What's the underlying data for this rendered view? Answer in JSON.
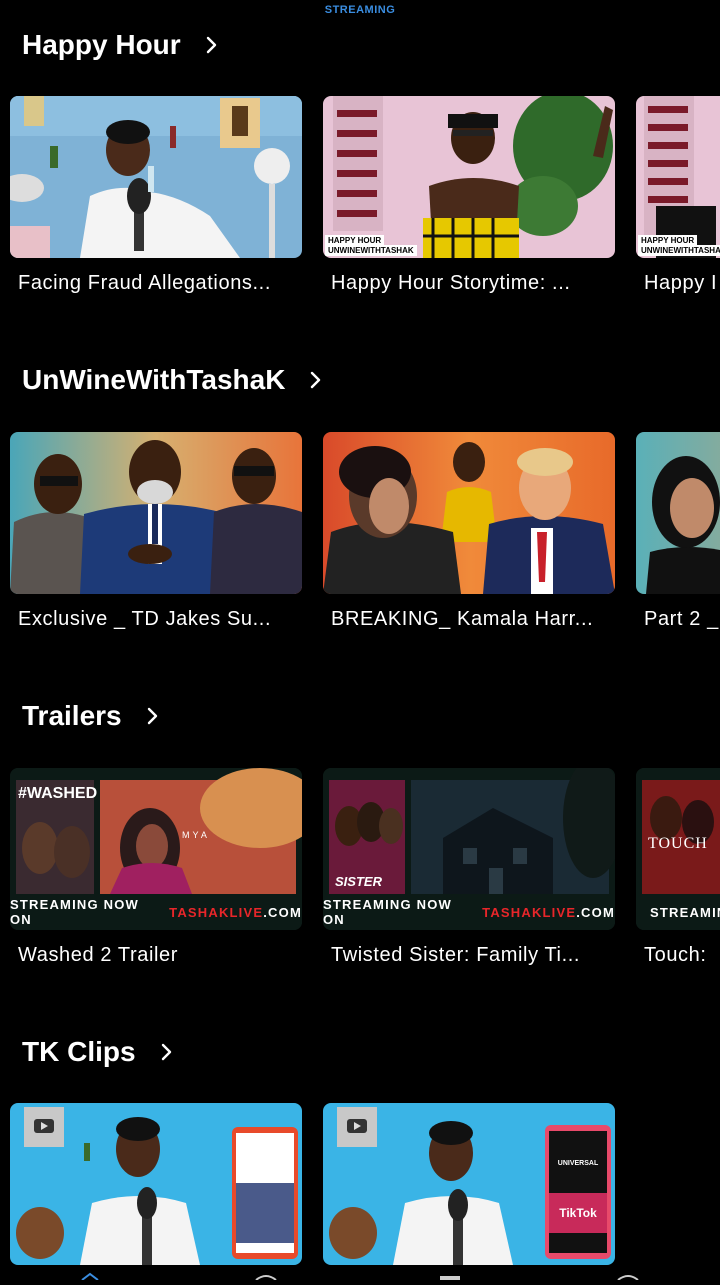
{
  "header": {
    "label": "STREAMING"
  },
  "sections": [
    {
      "title": "Happy Hour",
      "items": [
        {
          "title": "Facing Fraud Allegations..."
        },
        {
          "title": "Happy Hour Storytime: ...",
          "badge_top": "HAPPY HOUR",
          "badge_bottom": "UNWINEWITHTASHAK"
        },
        {
          "title": "Happy I",
          "badge_top": "HAPPY HOUR",
          "badge_bottom": "UNWINEWITHTASHAK"
        }
      ]
    },
    {
      "title": "UnWineWithTashaK",
      "items": [
        {
          "title": "Exclusive _ TD Jakes Su..."
        },
        {
          "title": "BREAKING_ Kamala Harr..."
        },
        {
          "title": "Part 2 _"
        }
      ]
    },
    {
      "title": "Trailers",
      "items": [
        {
          "title": "Washed 2 Trailer",
          "poster_text": "#WASHED",
          "overlay_text": "MYA",
          "band_prefix": "STREAMING NOW ON",
          "band_brand": "TASHAKLIVE",
          "band_suffix": ".COM"
        },
        {
          "title": "Twisted Sister: Family Ti...",
          "poster_text": "SISTER",
          "band_prefix": "STREAMING NOW ON",
          "band_brand": "TASHAKLIVE",
          "band_suffix": ".COM"
        },
        {
          "title": "Touch:",
          "poster_text": "TOUCH",
          "band_prefix": "STREAMIN"
        }
      ]
    },
    {
      "title": "TK Clips",
      "items": [
        {
          "title": ""
        },
        {
          "title": "",
          "sign_text": "TikTok",
          "sign_text2": "UNIVERSAL"
        }
      ]
    }
  ],
  "colors": {
    "background": "#000000",
    "accent": "#3a8de0",
    "brand_red": "#e8262a"
  }
}
